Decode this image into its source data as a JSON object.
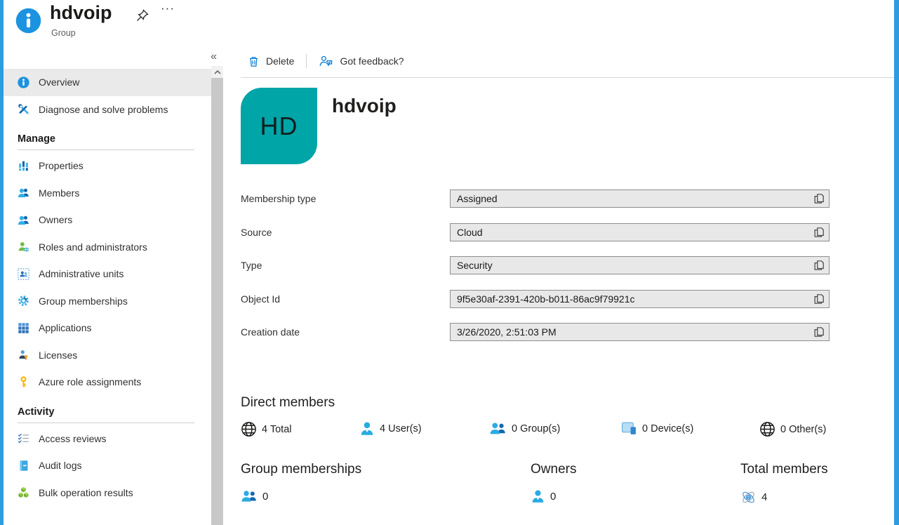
{
  "app": {
    "title": "hdvoip",
    "subtitle": "Group",
    "collapse_glyph": "«",
    "more_glyph": "···"
  },
  "sidebar": {
    "top_items": [
      {
        "label": "Overview"
      },
      {
        "label": "Diagnose and solve problems"
      }
    ],
    "sections": [
      {
        "title": "Manage",
        "items": [
          {
            "label": "Properties"
          },
          {
            "label": "Members"
          },
          {
            "label": "Owners"
          },
          {
            "label": "Roles and administrators"
          },
          {
            "label": "Administrative units"
          },
          {
            "label": "Group memberships"
          },
          {
            "label": "Applications"
          },
          {
            "label": "Licenses"
          },
          {
            "label": "Azure role assignments"
          }
        ]
      },
      {
        "title": "Activity",
        "items": [
          {
            "label": "Access reviews"
          },
          {
            "label": "Audit logs"
          },
          {
            "label": "Bulk operation results"
          }
        ]
      }
    ]
  },
  "toolbar": {
    "delete_label": "Delete",
    "feedback_label": "Got feedback?"
  },
  "overview": {
    "avatar_initials": "HD",
    "title": "hdvoip",
    "fields": [
      {
        "label": "Membership type",
        "value": "Assigned"
      },
      {
        "label": "Source",
        "value": "Cloud"
      },
      {
        "label": "Type",
        "value": "Security"
      },
      {
        "label": "Object Id",
        "value": "9f5e30af-2391-420b-b011-86ac9f79921c"
      },
      {
        "label": "Creation date",
        "value": "3/26/2020, 2:51:03 PM"
      }
    ],
    "direct_members": {
      "title": "Direct members",
      "stats": [
        {
          "value": "4",
          "label": "Total"
        },
        {
          "value": "4",
          "label": "User(s)"
        },
        {
          "value": "0",
          "label": "Group(s)"
        },
        {
          "value": "0",
          "label": "Device(s)"
        },
        {
          "value": "0",
          "label": "Other(s)"
        }
      ]
    },
    "summary": [
      {
        "title": "Group memberships",
        "value": "0"
      },
      {
        "title": "Owners",
        "value": "0"
      },
      {
        "title": "Total members",
        "value": "4"
      }
    ]
  },
  "colors": {
    "accent": "#0078d4",
    "avatar_bg": "#00a5a8",
    "edge_stripe": "#2d9ce0",
    "selected_bg": "#eaeaea"
  }
}
